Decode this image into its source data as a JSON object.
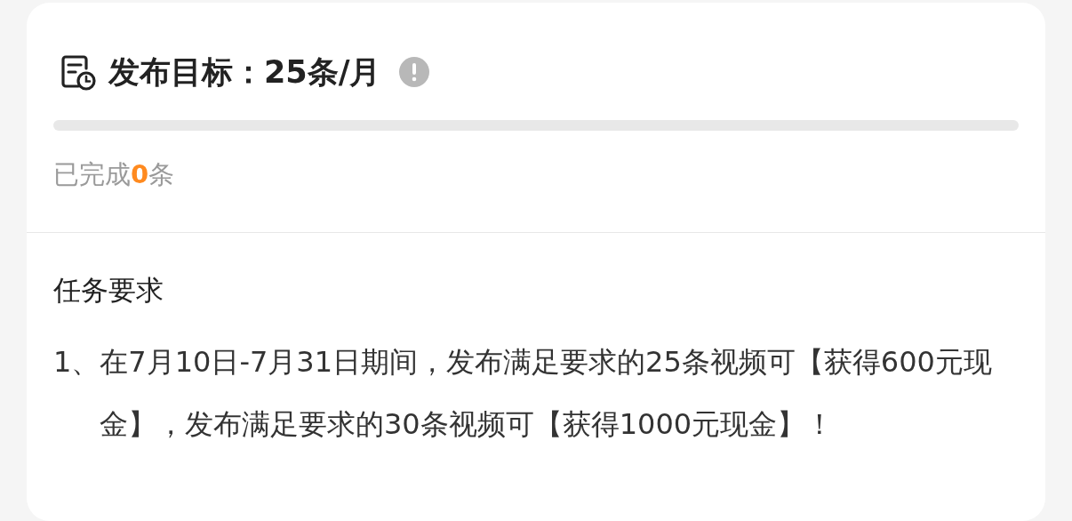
{
  "goal": {
    "title": "发布目标：25条/月",
    "level": 0
  },
  "progress": {
    "prefix": "已完成",
    "count": "0",
    "suffix": "条"
  },
  "requirements": {
    "heading": "任务要求",
    "items": [
      "1、在7月10日-7月31日期间，发布满足要求的25条视频可【获得600元现金】，发布满足要求的30条视频可【获得1000元现金】！"
    ]
  }
}
